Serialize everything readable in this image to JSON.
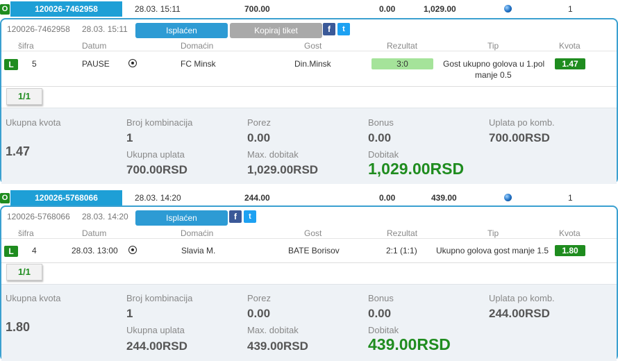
{
  "tickets": [
    {
      "summary": {
        "status": "O",
        "id": "120026-7462958",
        "datetime": "28.03. 15:11",
        "stake": "700.00",
        "zero": "0.00",
        "win": "1,029.00",
        "count": "1"
      },
      "detail": {
        "id": "120026-7462958",
        "datetime": "28.03. 15:11",
        "paid_label": "Isplaćen",
        "copy_label": "Kopiraj tiket",
        "fb": "f",
        "tw": "t"
      },
      "columns": [
        "šifra",
        "Datum",
        "Domaćin",
        "Gost",
        "Rezultat",
        "Tip",
        "Kvota"
      ],
      "match": {
        "status": "L",
        "code": "5",
        "date": "PAUSE",
        "home": "FC Minsk",
        "away": "Din.Minsk",
        "result": "3:0",
        "tip_line1": "Gost ukupno golova u 1.pol",
        "tip_line2": "manje 0.5",
        "odds": "1.47"
      },
      "pager": "1/1",
      "totals": {
        "total_odds_label": "Ukupna kvota",
        "total_odds": "1.47",
        "combos_label": "Broj kombinacija",
        "combos": "1",
        "tax_label": "Porez",
        "tax": "0.00",
        "bonus_label": "Bonus",
        "bonus": "0.00",
        "per_combo_label": "Uplata po komb.",
        "per_combo": "700.00RSD",
        "total_stake_label": "Ukupna uplata",
        "total_stake": "700.00RSD",
        "max_win_label": "Max. dobitak",
        "max_win": "1,029.00RSD",
        "win_label": "Dobitak",
        "win": "1,029.00RSD"
      }
    },
    {
      "summary": {
        "status": "O",
        "id": "120026-5768066",
        "datetime": "28.03. 14:20",
        "stake": "244.00",
        "zero": "0.00",
        "win": "439.00",
        "count": "1"
      },
      "detail": {
        "id": "120026-5768066",
        "datetime": "28.03. 14:20",
        "paid_label": "Isplaćen",
        "fb": "f",
        "tw": "t"
      },
      "columns": [
        "šifra",
        "Datum",
        "Domaćin",
        "Gost",
        "Rezultat",
        "Tip",
        "Kvota"
      ],
      "match": {
        "status": "L",
        "code": "4",
        "date": "28.03. 13:00",
        "home": "Slavia M.",
        "away": "BATE Borisov",
        "result": "2:1 (1:1)",
        "tip_line1": "Ukupno golova gost manje 1.5",
        "odds": "1.80"
      },
      "pager": "1/1",
      "totals": {
        "total_odds_label": "Ukupna kvota",
        "total_odds": "1.80",
        "combos_label": "Broj kombinacija",
        "combos": "1",
        "tax_label": "Porez",
        "tax": "0.00",
        "bonus_label": "Bonus",
        "bonus": "0.00",
        "per_combo_label": "Uplata po komb.",
        "per_combo": "244.00RSD",
        "total_stake_label": "Ukupna uplata",
        "total_stake": "244.00RSD",
        "max_win_label": "Max. dobitak",
        "max_win": "439.00RSD",
        "win_label": "Dobitak",
        "win": "439.00RSD"
      }
    }
  ]
}
